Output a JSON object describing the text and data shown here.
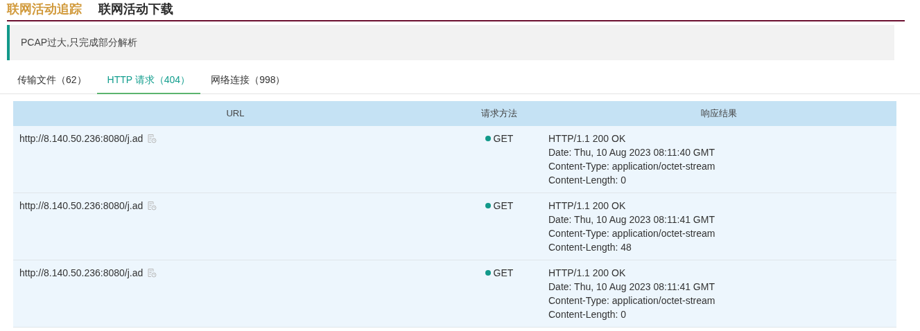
{
  "header_tabs": [
    {
      "label": "联网活动追踪",
      "selected": true
    },
    {
      "label": "联网活动下载",
      "selected": false
    }
  ],
  "alert": {
    "text": "PCAP过大,只完成部分解析"
  },
  "tabs": [
    {
      "label": "传输文件（62）",
      "selected": false
    },
    {
      "label": "HTTP 请求（404）",
      "selected": true
    },
    {
      "label": "网络连接（998）",
      "selected": false
    }
  ],
  "table": {
    "columns": [
      "URL",
      "请求方法",
      "响应结果"
    ],
    "rows": [
      {
        "url": "http://8.140.50.236:8080/j.ad",
        "method": "GET",
        "response": [
          "HTTP/1.1 200 OK",
          "Date: Thu, 10 Aug 2023 08:11:40 GMT",
          "Content-Type: application/octet-stream",
          "Content-Length: 0"
        ]
      },
      {
        "url": "http://8.140.50.236:8080/j.ad",
        "method": "GET",
        "response": [
          "HTTP/1.1 200 OK",
          "Date: Thu, 10 Aug 2023 08:11:41 GMT",
          "Content-Type: application/octet-stream",
          "Content-Length: 48"
        ]
      },
      {
        "url": "http://8.140.50.236:8080/j.ad",
        "method": "GET",
        "response": [
          "HTTP/1.1 200 OK",
          "Date: Thu, 10 Aug 2023 08:11:41 GMT",
          "Content-Type: application/octet-stream",
          "Content-Length: 0"
        ]
      }
    ]
  }
}
